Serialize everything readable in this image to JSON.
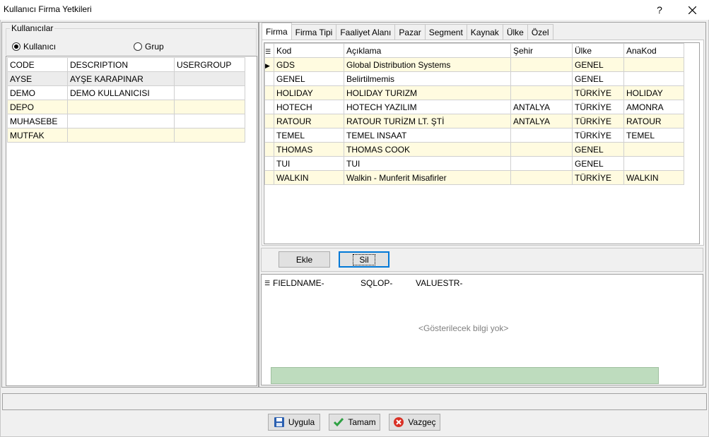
{
  "window": {
    "title": "Kullanıcı Firma Yetkileri",
    "help": "?"
  },
  "users": {
    "legend": "Kullanıcılar",
    "radio_user": "Kullanıcı",
    "radio_group": "Grup",
    "columns": [
      "CODE",
      "DESCRIPTION",
      "USERGROUP"
    ],
    "rows": [
      {
        "code": "AYSE",
        "description": "AYŞE KARAPINAR",
        "usergroup": ""
      },
      {
        "code": "DEMO",
        "description": "DEMO KULLANICISI",
        "usergroup": ""
      },
      {
        "code": "DEPO",
        "description": "",
        "usergroup": ""
      },
      {
        "code": "MUHASEBE",
        "description": "",
        "usergroup": ""
      },
      {
        "code": "MUTFAK",
        "description": "",
        "usergroup": ""
      }
    ]
  },
  "tabs": [
    "Firma",
    "Firma Tipi",
    "Faaliyet Alanı",
    "Pazar",
    "Segment",
    "Kaynak",
    "Ülke",
    "Özel"
  ],
  "firma": {
    "columns": [
      "Kod",
      "Açıklama",
      "Şehir",
      "Ülke",
      "AnaKod"
    ],
    "rows": [
      {
        "kod": "GDS",
        "aciklama": "Global Distribution Systems",
        "sehir": "",
        "ulke": "GENEL",
        "anakod": ""
      },
      {
        "kod": "GENEL",
        "aciklama": "Belirtilmemis",
        "sehir": "",
        "ulke": "GENEL",
        "anakod": ""
      },
      {
        "kod": "HOLIDAY",
        "aciklama": "HOLIDAY TURIZM",
        "sehir": "",
        "ulke": "TÜRKİYE",
        "anakod": "HOLIDAY"
      },
      {
        "kod": "HOTECH",
        "aciklama": "HOTECH YAZILIM",
        "sehir": "ANTALYA",
        "ulke": "TÜRKİYE",
        "anakod": "AMONRA"
      },
      {
        "kod": "RATOUR",
        "aciklama": "RATOUR TURİZM LT. ŞTİ",
        "sehir": "ANTALYA",
        "ulke": "TÜRKİYE",
        "anakod": "RATOUR"
      },
      {
        "kod": "TEMEL",
        "aciklama": "TEMEL INSAAT",
        "sehir": "",
        "ulke": "TÜRKİYE",
        "anakod": "TEMEL"
      },
      {
        "kod": "THOMAS",
        "aciklama": "THOMAS COOK",
        "sehir": "",
        "ulke": "GENEL",
        "anakod": ""
      },
      {
        "kod": "TUI",
        "aciklama": "TUI",
        "sehir": "",
        "ulke": "GENEL",
        "anakod": ""
      },
      {
        "kod": "WALKIN",
        "aciklama": "Walkin - Munferit Misafirler",
        "sehir": "",
        "ulke": "TÜRKİYE",
        "anakod": "WALKIN"
      }
    ]
  },
  "actions": {
    "add": "Ekle",
    "delete": "Sil"
  },
  "filter": {
    "columns": [
      "FIELDNAME-",
      "SQLOP-",
      "VALUESTR-"
    ],
    "empty": "<Gösterilecek bilgi yok>"
  },
  "footer": {
    "apply": "Uygula",
    "ok": "Tamam",
    "cancel": "Vazgeç"
  },
  "colors": {
    "alt_row": "#fffbe0",
    "selected_row": "#ececec",
    "footer_band": "#bedcbe",
    "focus": "#0078d7"
  }
}
